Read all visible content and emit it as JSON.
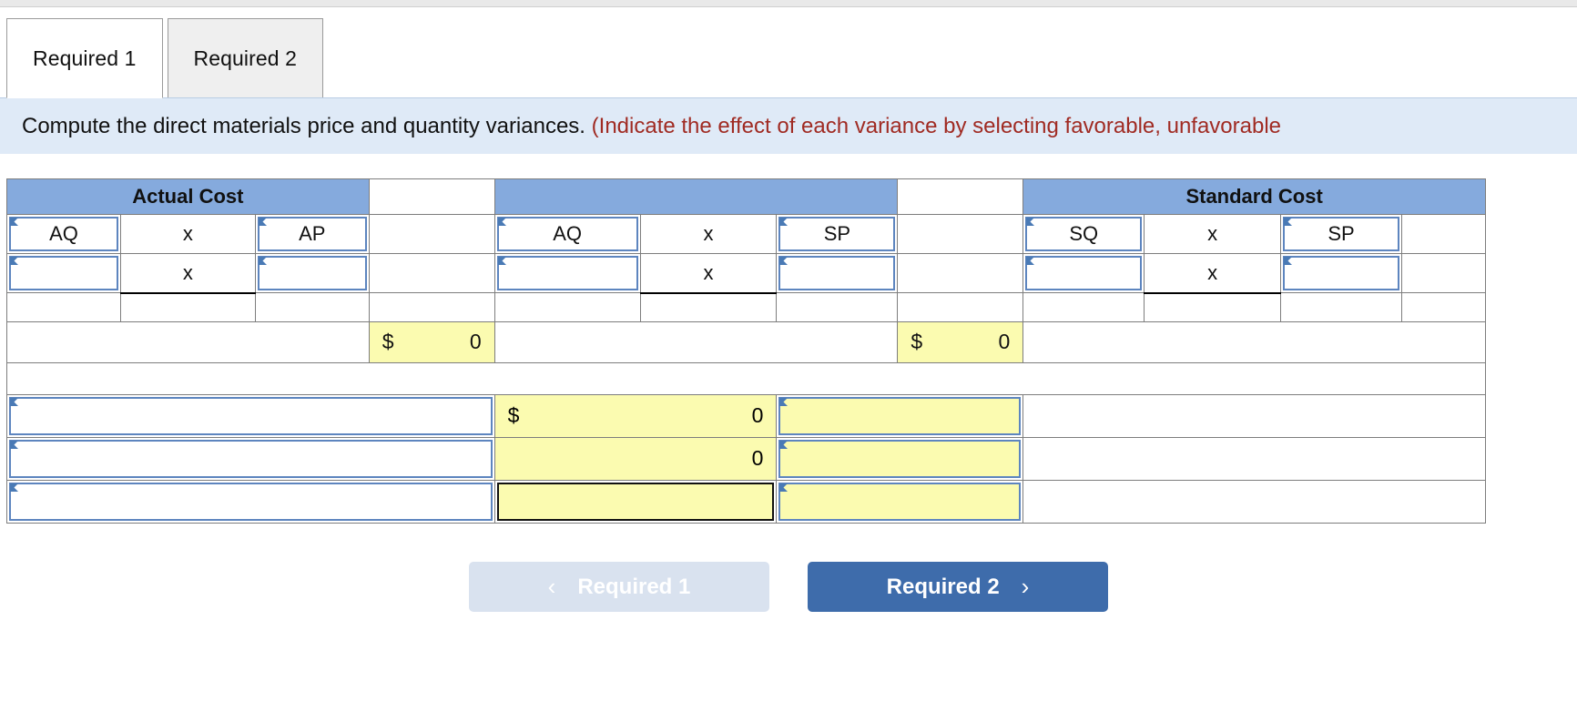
{
  "tabs": [
    {
      "label": "Required 1",
      "active": true
    },
    {
      "label": "Required 2",
      "active": false
    }
  ],
  "instruction": {
    "main": "Compute the direct materials price and quantity variances.",
    "hint": "(Indicate the effect of each variance by selecting favorable, unfavorable"
  },
  "table": {
    "group_headers": {
      "actual_cost": "Actual Cost",
      "middle": "",
      "mid_right": "",
      "standard_cost": "Standard Cost"
    },
    "label_row": {
      "aq_left": "AQ",
      "x1": "x",
      "ap": "AP",
      "aq_mid": "AQ",
      "x2": "x",
      "sp_mid": "SP",
      "sq": "SQ",
      "x3": "x",
      "sp_right": "SP"
    },
    "value_row": {
      "aq_left": "",
      "x1": "x",
      "ap": "",
      "aq_mid": "",
      "x2": "x",
      "sp_mid": "",
      "sq": "",
      "x3": "x",
      "sp_right": ""
    },
    "totals": {
      "left_symbol": "$",
      "left_value": "0",
      "right_symbol": "$",
      "right_value": "0"
    }
  },
  "variances": [
    {
      "label": "",
      "symbol": "$",
      "amount": "0",
      "effect": "",
      "focused": false
    },
    {
      "label": "",
      "symbol": "",
      "amount": "0",
      "effect": "",
      "focused": false
    },
    {
      "label": "",
      "symbol": "",
      "amount": "",
      "effect": "",
      "focused": true
    }
  ],
  "nav": {
    "prev_label": "Required 1",
    "prev_icon": "chevron-left-icon",
    "next_label": "Required 2",
    "next_icon": "chevron-right-icon"
  },
  "colors": {
    "header_blue": "#85aadd",
    "input_border_blue": "#5d85bf",
    "yellow_fill": "#fbfbb0",
    "instruction_bg": "#dfeaf7",
    "hint_red": "#a02b23",
    "next_btn": "#3e6cab",
    "prev_btn": "#d9e2ef"
  },
  "glyphs": {
    "chevron_left": "‹",
    "chevron_right": "›"
  }
}
